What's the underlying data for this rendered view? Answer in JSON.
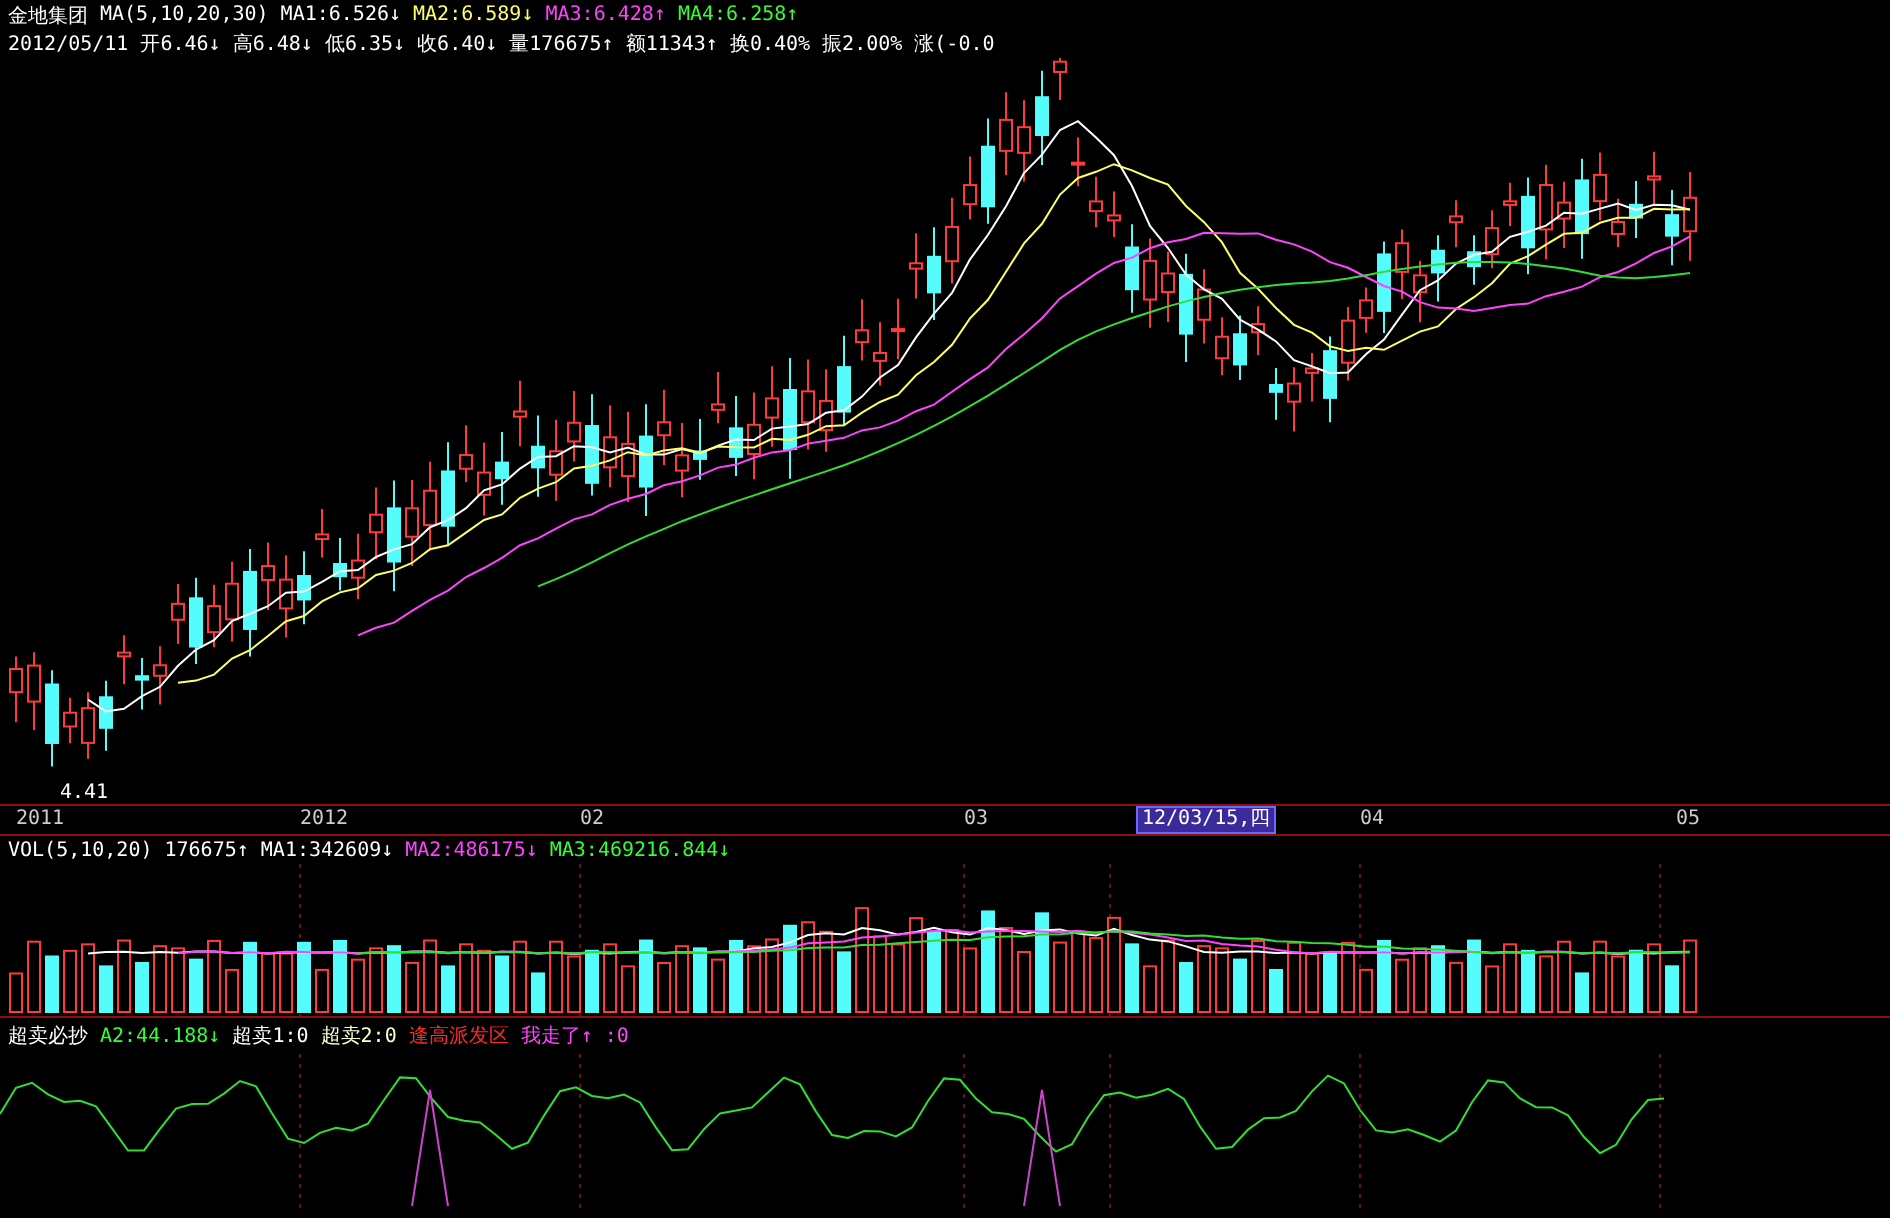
{
  "header": {
    "stock_name": "金地集团",
    "ma_label": "MA(5,10,20,30)",
    "ma_values": [
      {
        "text": "MA1:6.526↓",
        "color": "#ffffff"
      },
      {
        "text": "MA2:6.589↓",
        "color": "#ffff66"
      },
      {
        "text": "MA3:6.428↑",
        "color": "#ff44ff"
      },
      {
        "text": "MA4:6.258↑",
        "color": "#33ff33"
      }
    ]
  },
  "quote": {
    "date": "2012/05/11",
    "fields": [
      "开6.46↓",
      "高6.48↓",
      "低6.35↓",
      "收6.40↓",
      "量176675↑",
      "额11343↑",
      "换0.40%",
      "振2.00%",
      "涨(-0.0"
    ]
  },
  "main_chart": {
    "low_label": "4.41"
  },
  "time_axis": {
    "labels": [
      {
        "text": "2011",
        "kind": "tick"
      },
      {
        "text": "2012",
        "kind": "tick"
      },
      {
        "text": "02",
        "kind": "tick"
      },
      {
        "text": "03",
        "kind": "tick"
      },
      {
        "text": "12/03/15,四",
        "kind": "cursor"
      },
      {
        "text": "04",
        "kind": "tick"
      },
      {
        "text": "05",
        "kind": "tick"
      }
    ]
  },
  "volume": {
    "items": [
      {
        "text": "VOL(5,10,20)",
        "color": "#ffffff"
      },
      {
        "text": "176675↑",
        "color": "#ffffff"
      },
      {
        "text": "MA1:342609↓",
        "color": "#ffffff"
      },
      {
        "text": "MA2:486175↓",
        "color": "#ff44ff"
      },
      {
        "text": "MA3:469216.844↓",
        "color": "#33ff33"
      }
    ]
  },
  "indicator": {
    "items": [
      {
        "text": "超卖必抄",
        "color": "#ffffff"
      },
      {
        "text": "A2:44.188↓",
        "color": "#33ff33"
      },
      {
        "text": "超卖1:0",
        "color": "#ffffff"
      },
      {
        "text": "超卖2:0",
        "color": "#ffffcc"
      },
      {
        "text": "逢高派发区",
        "color": "#ff2a2a"
      },
      {
        "text": "我走了↑ :0",
        "color": "#ff44ff"
      }
    ]
  }
}
